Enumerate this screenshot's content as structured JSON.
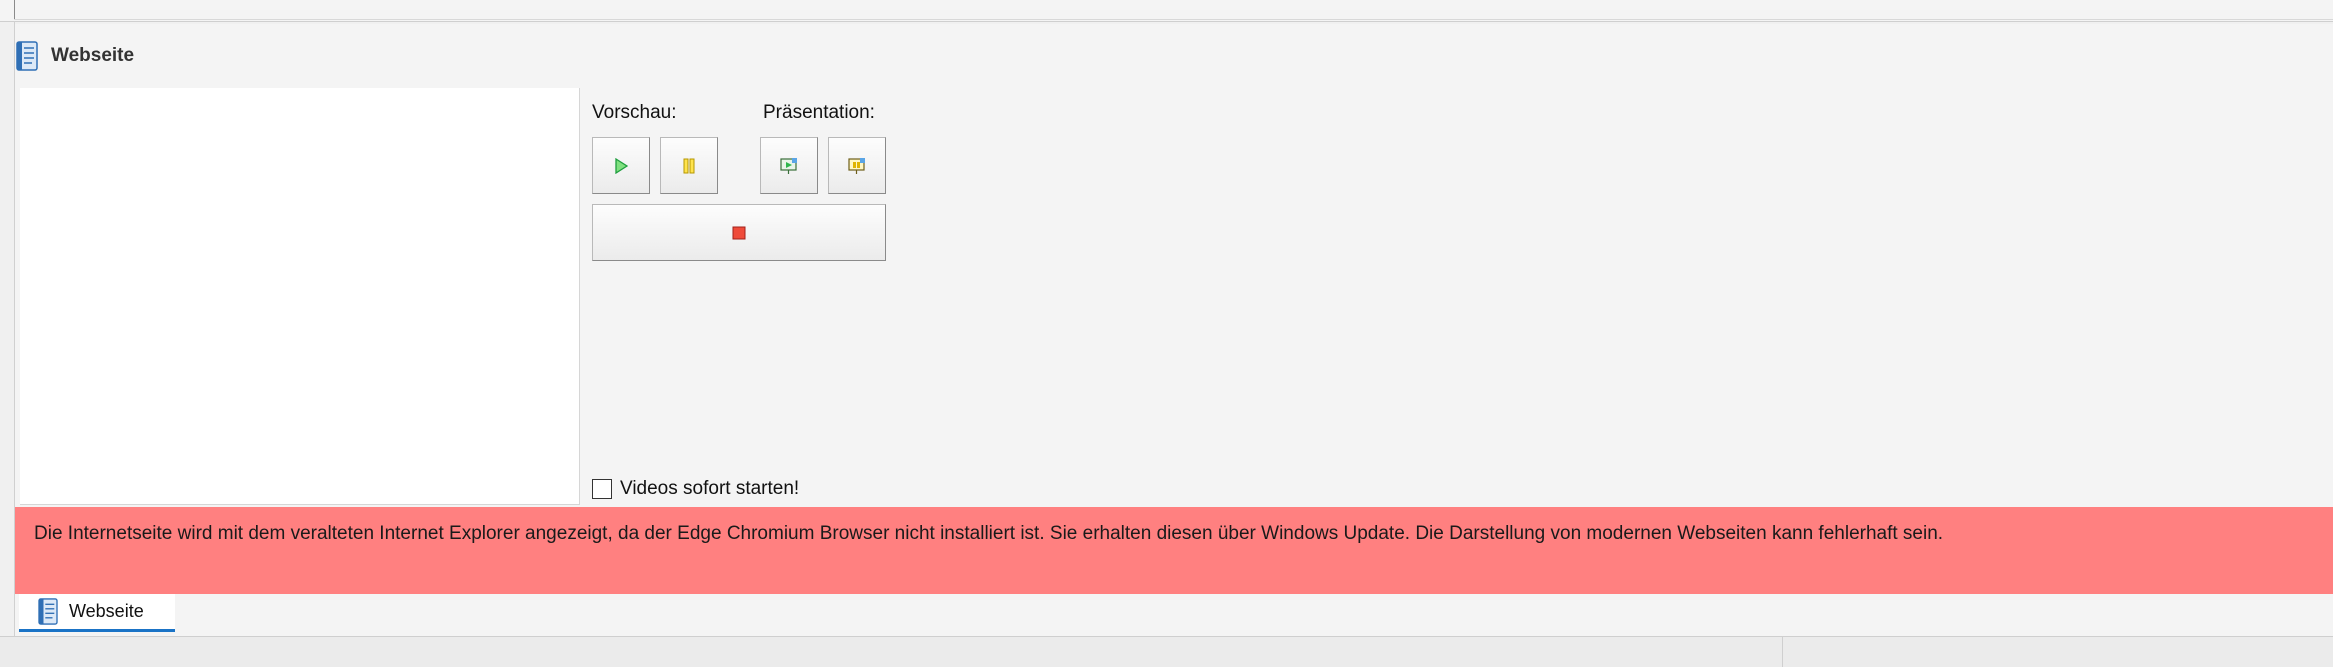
{
  "panel": {
    "title": "Webseite",
    "icon": "document-icon"
  },
  "controls": {
    "preview_label": "Vorschau:",
    "presentation_label": "Präsentation:",
    "buttons": {
      "play": {
        "icon": "play-icon",
        "color": "#22b14c"
      },
      "pause": {
        "icon": "pause-icon",
        "color": "#e5c000"
      },
      "present_start": {
        "icon": "presentation-start-icon"
      },
      "present_stop": {
        "icon": "presentation-stop-icon"
      },
      "stop": {
        "icon": "stop-icon",
        "color": "#e53935"
      }
    },
    "autostart_checkbox": {
      "label": "Videos sofort starten!",
      "checked": false
    }
  },
  "warning": {
    "text": "Die Internetseite wird mit dem veralteten Internet Explorer angezeigt, da der Edge Chromium Browser nicht installiert ist. Sie erhalten diesen über Windows Update. Die Darstellung von modernen Webseiten kann fehlerhaft sein.",
    "background": "#ff8080"
  },
  "tabs": [
    {
      "label": "Webseite",
      "icon": "document-icon",
      "active": true
    }
  ],
  "colors": {
    "accent": "#1a73c6"
  }
}
